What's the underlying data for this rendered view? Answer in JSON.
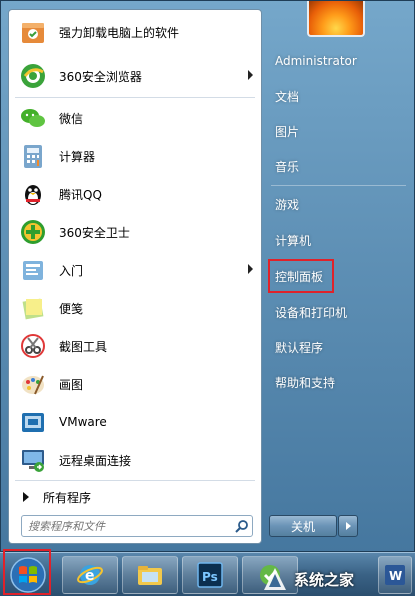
{
  "programs": [
    {
      "label": "强力卸载电脑上的软件",
      "icon": "uninstall-box-icon",
      "has_submenu": false
    },
    {
      "label": "360安全浏览器",
      "icon": "360-browser-icon",
      "has_submenu": true
    },
    {
      "label": "微信",
      "icon": "wechat-icon",
      "has_submenu": false
    },
    {
      "label": "计算器",
      "icon": "calculator-icon",
      "has_submenu": false
    },
    {
      "label": "腾讯QQ",
      "icon": "qq-penguin-icon",
      "has_submenu": false
    },
    {
      "label": "360安全卫士",
      "icon": "360-safeguard-icon",
      "has_submenu": false
    },
    {
      "label": "入门",
      "icon": "getting-started-icon",
      "has_submenu": true
    },
    {
      "label": "便笺",
      "icon": "sticky-notes-icon",
      "has_submenu": false
    },
    {
      "label": "截图工具",
      "icon": "snipping-tool-icon",
      "has_submenu": false
    },
    {
      "label": "画图",
      "icon": "paint-palette-icon",
      "has_submenu": false
    },
    {
      "label": "VMware",
      "icon": "vmware-icon",
      "has_submenu": false
    },
    {
      "label": "远程桌面连接",
      "icon": "remote-desktop-icon",
      "has_submenu": false
    }
  ],
  "all_programs_label": "所有程序",
  "search": {
    "placeholder": "搜索程序和文件"
  },
  "right_pane": {
    "items": [
      {
        "label": "Administrator",
        "name": "user-name"
      },
      {
        "label": "文档",
        "name": "documents"
      },
      {
        "label": "图片",
        "name": "pictures"
      },
      {
        "label": "音乐",
        "name": "music"
      },
      {
        "label": "游戏",
        "name": "games"
      },
      {
        "label": "计算机",
        "name": "computer"
      },
      {
        "label": "控制面板",
        "name": "control-panel"
      },
      {
        "label": "设备和打印机",
        "name": "devices-printers"
      },
      {
        "label": "默认程序",
        "name": "default-programs"
      },
      {
        "label": "帮助和支持",
        "name": "help-support"
      }
    ],
    "shutdown_label": "关机"
  },
  "taskbar": {
    "buttons": [
      "ie-browser-icon",
      "file-explorer-icon",
      "photoshop-icon",
      "green-app-icon",
      "word-icon"
    ],
    "ps_text": "Ps"
  },
  "watermark": {
    "text": "系统之家"
  },
  "colors": {
    "highlight": "#e0222a",
    "menu_text": "#ffffff"
  }
}
